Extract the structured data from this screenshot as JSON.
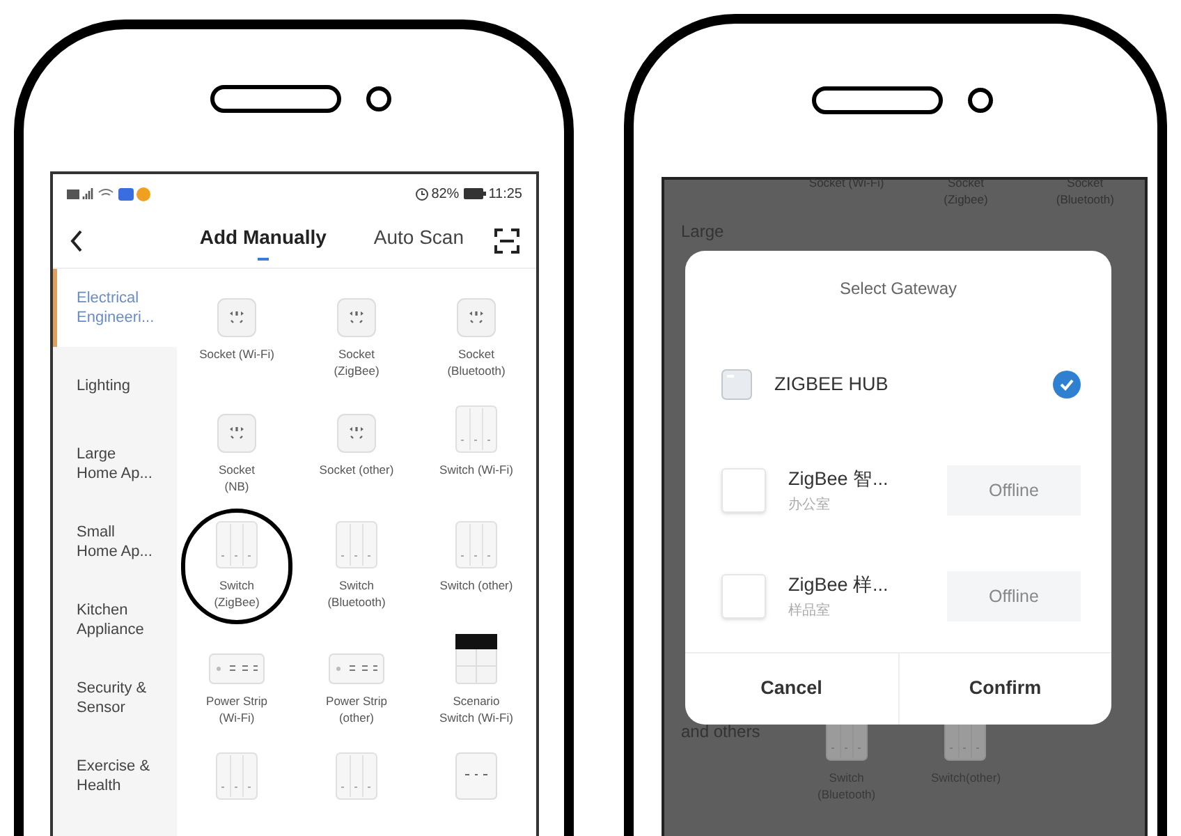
{
  "left_phone": {
    "status_bar": {
      "battery": "82%",
      "time": "11:25"
    },
    "tabs": [
      {
        "label": "Add Manually",
        "selected": true
      },
      {
        "label": "Auto Scan",
        "selected": false
      }
    ],
    "categories": [
      {
        "label": "Electrical Engineeri...",
        "selected": true
      },
      {
        "label": "Lighting",
        "selected": false
      },
      {
        "label": "Large Home Ap...",
        "selected": false
      },
      {
        "label": "Small Home Ap...",
        "selected": false
      },
      {
        "label": "Kitchen Appliance",
        "selected": false
      },
      {
        "label": "Security & Sensor",
        "selected": false
      },
      {
        "label": "Exercise & Health",
        "selected": false
      }
    ],
    "devices": [
      {
        "kind": "socket",
        "label": "Socket (Wi-Fi)",
        "highlighted": false
      },
      {
        "kind": "socket",
        "label": "Socket\n(ZigBee)",
        "highlighted": false
      },
      {
        "kind": "socket",
        "label": "Socket\n(Bluetooth)",
        "highlighted": false
      },
      {
        "kind": "socket",
        "label": "Socket\n(NB)",
        "highlighted": false
      },
      {
        "kind": "socket",
        "label": "Socket (other)",
        "highlighted": false
      },
      {
        "kind": "switch",
        "label": "Switch (Wi-Fi)",
        "highlighted": false
      },
      {
        "kind": "switch",
        "label": "Switch\n(ZigBee)",
        "highlighted": true
      },
      {
        "kind": "switch",
        "label": "Switch\n(Bluetooth)",
        "highlighted": false
      },
      {
        "kind": "switch",
        "label": "Switch (other)",
        "highlighted": false
      },
      {
        "kind": "strip",
        "label": "Power Strip\n(Wi-Fi)",
        "highlighted": false
      },
      {
        "kind": "strip",
        "label": "Power Strip\n(other)",
        "highlighted": false
      },
      {
        "kind": "scenario",
        "label": "Scenario\nSwitch (Wi-Fi)",
        "highlighted": false
      },
      {
        "kind": "switch",
        "highlighted": false
      },
      {
        "kind": "switch",
        "highlighted": false
      },
      {
        "kind": "panel",
        "highlighted": false
      }
    ]
  },
  "right_phone": {
    "background": {
      "device_labels": [
        "Socket (Wi-Fi)",
        "Socket\n(Zigbee)",
        "Socket\n(Bluetooth)"
      ],
      "sidebar": [
        "Large",
        "and others"
      ],
      "devices": [
        {
          "kind": "switch",
          "label": "Switch\n(Bluetooth)"
        },
        {
          "kind": "switch",
          "label": "Switch(other)"
        }
      ]
    },
    "dialog": {
      "title": "Select Gateway",
      "gateways": [
        {
          "kind": "hub",
          "name": "ZIGBEE HUB",
          "selected": true
        },
        {
          "kind": "device",
          "name": "ZigBee 智...",
          "room": "办公室",
          "status": "Offline",
          "selected": false
        },
        {
          "kind": "device",
          "name": "ZigBee 样...",
          "room": "样品室",
          "status": "Offline",
          "selected": false
        }
      ],
      "buttons": [
        "Cancel",
        "Confirm"
      ]
    }
  }
}
